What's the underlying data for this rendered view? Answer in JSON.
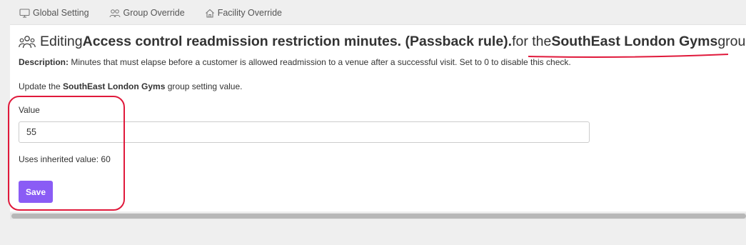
{
  "tabs": [
    {
      "label": "Global Setting",
      "icon": "monitor-icon"
    },
    {
      "label": "Group Override",
      "icon": "users-icon"
    },
    {
      "label": "Facility Override",
      "icon": "home-icon"
    }
  ],
  "heading": {
    "prefix": "Editing ",
    "setting_name": "Access control readmission restriction minutes. (Passback rule).",
    "for_text": " for the ",
    "group_name": "SouthEast London Gyms",
    "suffix": " group"
  },
  "description": {
    "label": "Description:",
    "text": " Minutes that must elapse before a customer is allowed readmission to a venue after a successful visit. Set to 0 to disable this check."
  },
  "update": {
    "prefix": "Update the ",
    "group_name": "SouthEast London Gyms",
    "suffix": " group setting value."
  },
  "form": {
    "value_label": "Value",
    "value": "55",
    "inherited_text": "Uses inherited value: 60",
    "save_label": "Save"
  },
  "colors": {
    "accent": "#8a5cf5",
    "annotation": "#e0193b"
  }
}
